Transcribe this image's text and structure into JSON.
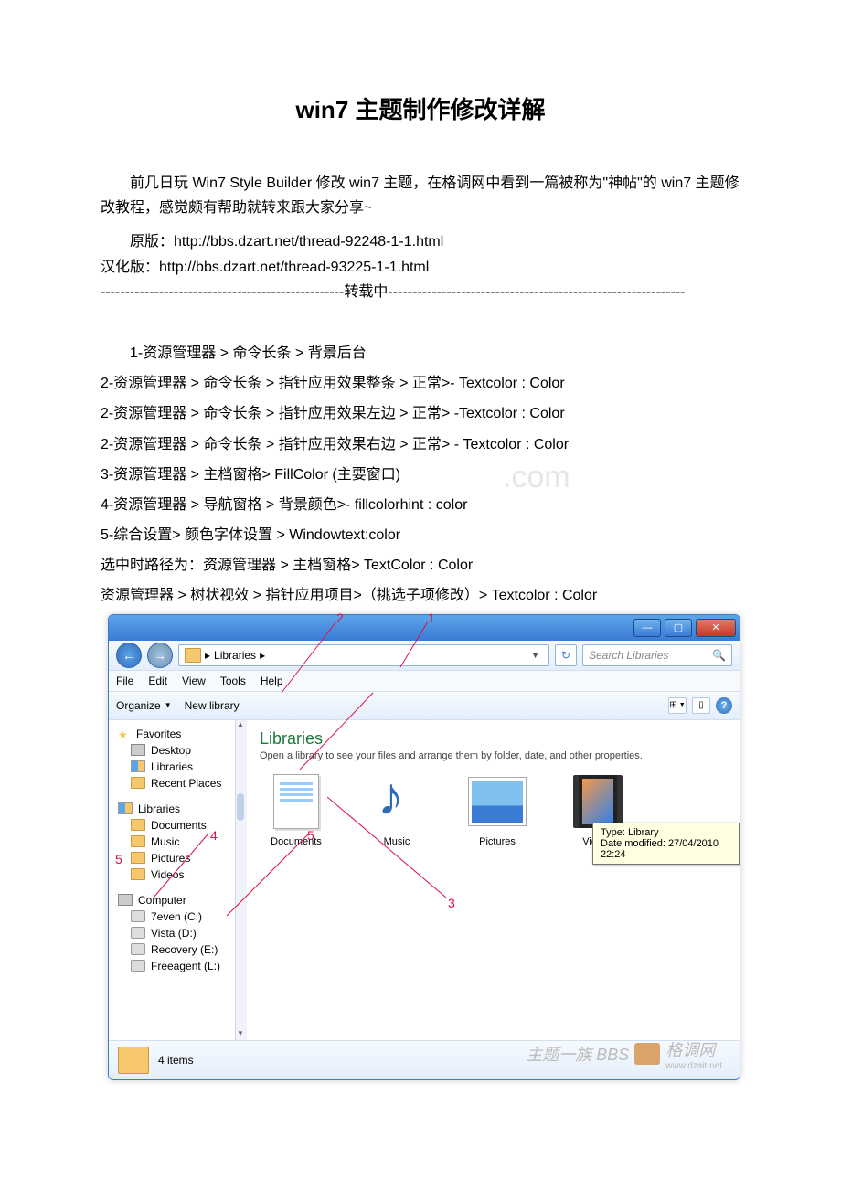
{
  "title": "win7 主题制作修改详解",
  "intro": "前几日玩 Win7 Style Builder 修改 win7 主题，在格调网中看到一篇被称为\"神帖\"的 win7 主题修改教程，感觉颇有帮助就转来跟大家分享~",
  "original_label": "原版：",
  "original_url": "http://bbs.dzart.net/thread-92248-1-1.html",
  "chinese_label": "汉化版：",
  "chinese_url": "http://bbs.dzart.net/thread-93225-1-1.html",
  "divider": "--------------------------------------------------转载中-------------------------------------------------------------",
  "list": [
    "1-资源管理器 > 命令长条 > 背景后台",
    "2-资源管理器 > 命令长条 > 指针应用效果整条 > 正常>- Textcolor : Color",
    "2-资源管理器 > 命令长条 > 指针应用效果左边 > 正常> -Textcolor : Color",
    "2-资源管理器 > 命令长条 > 指针应用效果右边 > 正常> - Textcolor : Color",
    "3-资源管理器 > 主档窗格> FillColor (主要窗口)",
    "4-资源管理器 > 导航窗格 > 背景颜色>- fillcolorhint : color",
    "5-综合设置> 颜色字体设置 > Windowtext:color",
    "选中时路径为：资源管理器 > 主档窗格> TextColor : Color",
    "资源管理器 > 树状视效 > 指针应用项目>（挑选子项修改）> Textcolor : Color"
  ],
  "explorer": {
    "breadcrumb_root": "Libraries",
    "breadcrumb_sep": "▸",
    "search_placeholder": "Search Libraries",
    "menubar": [
      "File",
      "Edit",
      "View",
      "Tools",
      "Help"
    ],
    "toolbar": {
      "organize": "Organize",
      "new_library": "New library"
    },
    "sidebar": {
      "favorites": "Favorites",
      "favorites_items": [
        "Desktop",
        "Libraries",
        "Recent Places"
      ],
      "libraries": "Libraries",
      "libraries_items": [
        "Documents",
        "Music",
        "Pictures",
        "Videos"
      ],
      "computer": "Computer",
      "computer_items": [
        "7even (C:)",
        "Vista (D:)",
        "Recovery (E:)",
        "Freeagent (L:)"
      ]
    },
    "main": {
      "title": "Libraries",
      "desc": "Open a library to see your files and arrange them by folder, date, and other properties.",
      "items": [
        "Documents",
        "Music",
        "Pictures",
        "Videos"
      ]
    },
    "tooltip": {
      "type": "Type: Library",
      "modified": "Date modified: 27/04/2010 22:24"
    },
    "status": "4 items"
  },
  "annotations": {
    "n1": "1",
    "n2": "2",
    "n3": "3",
    "n4": "4",
    "n5": "5",
    "n5b": "5"
  },
  "watermark": {
    "top": ".com",
    "bottom_main": "主题一族 BBS",
    "bottom_brand": "格调网",
    "bottom_url": "www.dzait.net"
  }
}
